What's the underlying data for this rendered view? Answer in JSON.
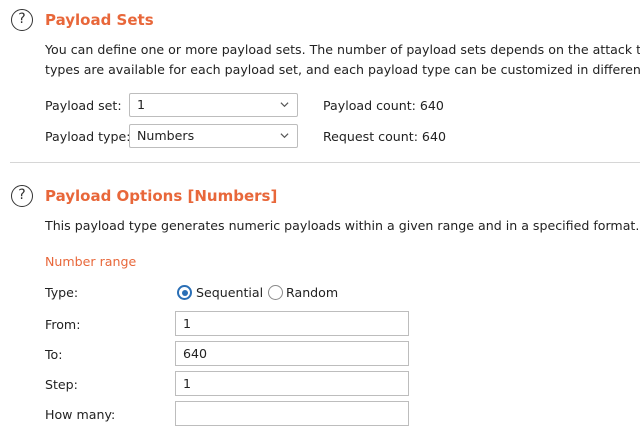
{
  "payload_sets": {
    "title": "Payload Sets",
    "description_line1": "You can define one or more payload sets. The number of payload sets depends on the attack typ",
    "description_line2": "types are available for each payload set, and each payload type can be customized in different wa",
    "payload_set_label": "Payload set:",
    "payload_set_value": "1",
    "payload_type_label": "Payload type:",
    "payload_type_value": "Numbers",
    "payload_count": "Payload count: 640",
    "request_count": "Request count: 640"
  },
  "payload_options": {
    "title": "Payload Options [Numbers]",
    "description": "This payload type generates numeric payloads within a given range and in a specified format.",
    "number_range_label": "Number range",
    "type_label": "Type:",
    "type_options": [
      "Sequential",
      "Random"
    ],
    "type_selected": "Sequential",
    "from_label": "From:",
    "from_value": "1",
    "to_label": "To:",
    "to_value": "640",
    "step_label": "Step:",
    "step_value": "1",
    "how_many_label": "How many:",
    "how_many_value": ""
  },
  "icons": {
    "help": "?",
    "chevron": "chevron-down-icon"
  },
  "colors": {
    "accent": "#e8673a",
    "radio_selected": "#2a6fb6"
  }
}
